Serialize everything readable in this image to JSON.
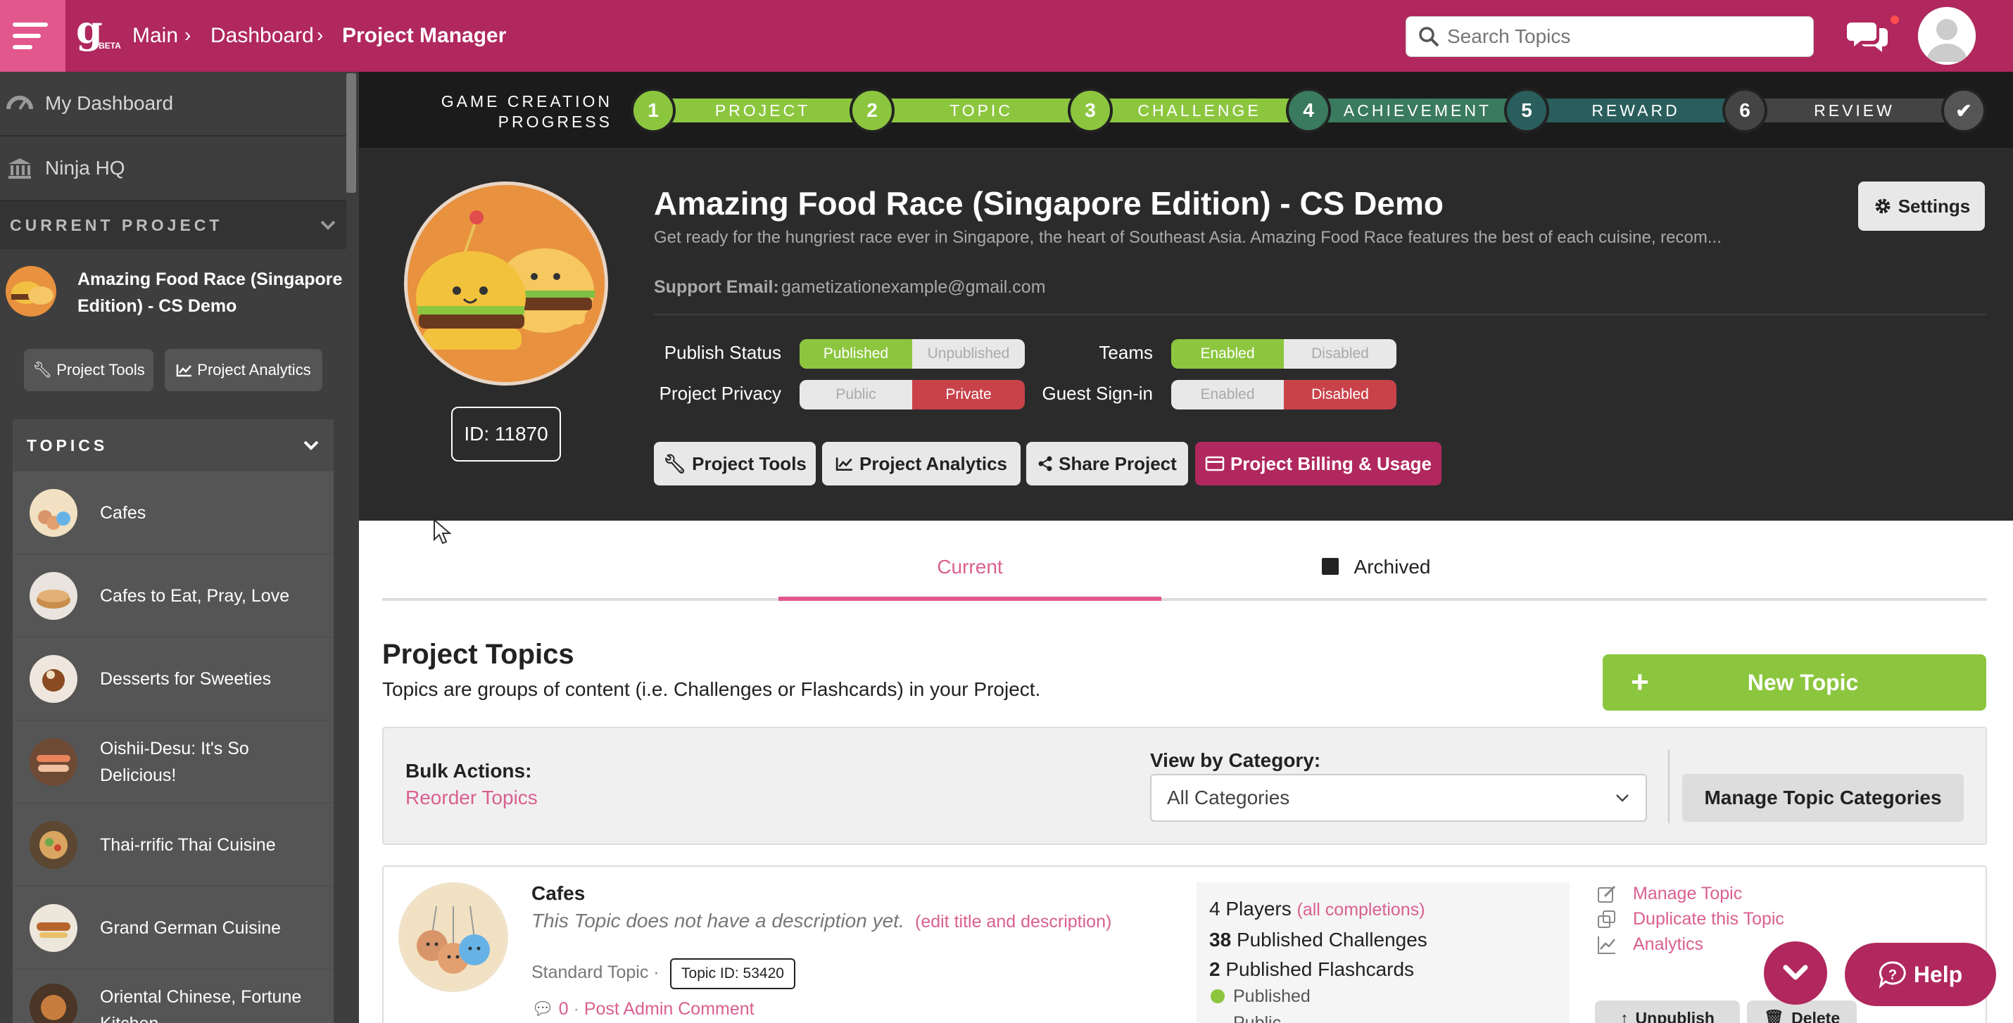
{
  "topbar": {
    "logo": "g",
    "logo_badge": "BETA",
    "breadcrumb": [
      "Main",
      "Dashboard",
      "Project Manager"
    ],
    "search_placeholder": "Search Topics"
  },
  "sidebar": {
    "nav": [
      {
        "label": "My Dashboard",
        "icon": "dashboard-icon"
      },
      {
        "label": "Ninja HQ",
        "icon": "bank-icon"
      }
    ],
    "current_project_heading": "CURRENT PROJECT",
    "current_project_name": "Amazing Food Race (Singapore Edition) - CS Demo",
    "buttons": {
      "tools": "Project Tools",
      "analytics": "Project Analytics"
    },
    "topics_heading": "TOPICS",
    "topics": [
      "Cafes",
      "Cafes to Eat, Pray, Love",
      "Desserts for Sweeties",
      "Oishii-Desu: It's So Delicious!",
      "Thai-rrific Thai Cuisine",
      "Grand German Cuisine",
      "Oriental Chinese, Fortune Kitchen"
    ]
  },
  "progress": {
    "label_line1": "GAME CREATION",
    "label_line2": "PROGRESS",
    "steps": [
      {
        "num": "1",
        "label": "PROJECT",
        "color": "#8cc63f"
      },
      {
        "num": "2",
        "label": "TOPIC",
        "color": "#8cc63f"
      },
      {
        "num": "3",
        "label": "CHALLENGE",
        "color": "#8cc63f"
      },
      {
        "num": "4",
        "label": "ACHIEVEMENT",
        "color": "#3a7a5e"
      },
      {
        "num": "5",
        "label": "REWARD",
        "color": "#2a5e5c"
      },
      {
        "num": "6",
        "label": "REVIEW",
        "color": "#444444"
      }
    ]
  },
  "project": {
    "title": "Amazing Food Race (Singapore Edition) - CS Demo",
    "description": "Get ready for the hungriest race ever in Singapore, the heart of Southeast Asia. Amazing Food Race features the best of each cuisine, recom...",
    "support_label": "Support Email:",
    "support_email": "gametizationexample@gmail.com",
    "id_label": "ID: 11870",
    "settings": "Settings",
    "toggles": {
      "publish_status": {
        "label": "Publish Status",
        "a": "Published",
        "b": "Unpublished",
        "active": "a"
      },
      "privacy": {
        "label": "Project Privacy",
        "a": "Public",
        "b": "Private",
        "active": "b"
      },
      "teams": {
        "label": "Teams",
        "a": "Enabled",
        "b": "Disabled",
        "active": "a"
      },
      "guest": {
        "label": "Guest Sign-in",
        "a": "Enabled",
        "b": "Disabled",
        "active": "b"
      }
    },
    "actions": {
      "tools": "Project Tools",
      "analytics": "Project Analytics",
      "share": "Share Project",
      "billing": "Project Billing & Usage"
    }
  },
  "tabs": {
    "current": "Current",
    "archived": "Archived"
  },
  "topics_section": {
    "title": "Project Topics",
    "subtitle": "Topics are groups of content (i.e. Challenges or Flashcards) in your Project.",
    "new_topic": "New Topic",
    "bulk_label": "Bulk Actions:",
    "reorder": "Reorder Topics",
    "category_label": "View by Category:",
    "category_value": "All Categories",
    "manage_categories": "Manage Topic Categories"
  },
  "topic_card": {
    "title": "Cafes",
    "description": "This Topic does not have a description yet.",
    "edit_link": "(edit title and description)",
    "type": "Standard Topic",
    "id_label": "Topic ID: 53420",
    "comment_count": "0",
    "post_comment": "Post Admin Comment",
    "players_num": "4",
    "players_label": "Players",
    "completions_link": "(all completions)",
    "challenges_num": "38",
    "challenges_label": "Published Challenges",
    "flashcards_num": "2",
    "flashcards_label": "Published Flashcards",
    "status": "Published",
    "privacy": "Public",
    "links": {
      "manage": "Manage Topic",
      "duplicate": "Duplicate this Topic",
      "analytics": "Analytics"
    },
    "unpublish": "Unpublish",
    "delete": "Delete"
  },
  "help": "Help"
}
